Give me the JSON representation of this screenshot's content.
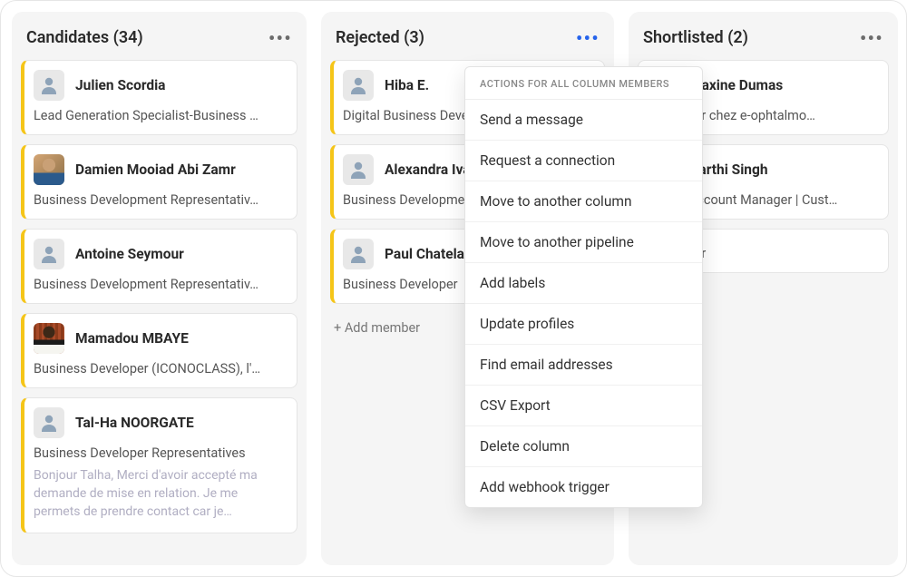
{
  "columns": {
    "candidates": {
      "title": "Candidates (34)",
      "cards": [
        {
          "name": "Julien Scordia",
          "subtitle": "Lead Generation Specialist-Business …"
        },
        {
          "name": "Damien Mooiad Abi Zamr",
          "subtitle": "Business Development Representativ…"
        },
        {
          "name": "Antoine Seymour",
          "subtitle": "Business Development Representativ…"
        },
        {
          "name": "Mamadou MBAYE",
          "subtitle": "Business Developer (ICONOCLASS), l'…"
        },
        {
          "name": "Tal-Ha NOORGATE",
          "subtitle": "Business Developer Representatives",
          "note": "Bonjour Talha, Merci d'avoir accepté ma demande de mise en relation. Je me permets de prendre contact car je…"
        }
      ]
    },
    "rejected": {
      "title": "Rejected (3)",
      "cards": [
        {
          "name": "Hiba E.",
          "subtitle": "Digital Business Developer"
        },
        {
          "name": "Alexandra Ivanov (She/Her)",
          "subtitle": "Business Development Representativ…"
        },
        {
          "name": "Paul Chatelain",
          "subtitle": "Business Developer"
        }
      ],
      "add_member": "+ Add member"
    },
    "shortlisted": {
      "title": "Shortlisted (2)",
      "cards": [
        {
          "name": "Maxine Dumas",
          "subtitle": "Developer chez e-ophtalmo…"
        },
        {
          "name": "Aarthi Singh",
          "subtitle": "Global Account Manager | Cust…"
        },
        {
          "name": "",
          "subtitle": "Developer"
        }
      ]
    }
  },
  "dropdown": {
    "header": "ACTIONS FOR ALL COLUMN MEMBERS",
    "items": [
      "Send a message",
      "Request a connection",
      "Move to another column",
      "Move to another pipeline",
      "Add labels",
      "Update profiles",
      "Find email addresses",
      "CSV Export",
      "Delete column",
      "Add webhook trigger"
    ]
  }
}
